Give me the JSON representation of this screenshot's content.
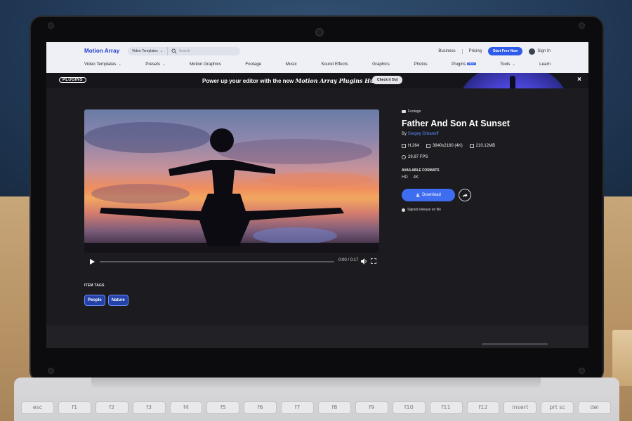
{
  "site": {
    "logo": "Motion Array",
    "search_category": "Video Templates",
    "search_placeholder": "Search",
    "top_links": [
      "Business",
      "Pricing"
    ],
    "start_button": "Start Free Now",
    "sign_in": "Sign In"
  },
  "nav": [
    {
      "label": "Video Templates",
      "chevron": true
    },
    {
      "label": "Presets",
      "chevron": true
    },
    {
      "label": "Motion Graphics"
    },
    {
      "label": "Footage"
    },
    {
      "label": "Music"
    },
    {
      "label": "Sound Effects"
    },
    {
      "label": "Graphics"
    },
    {
      "label": "Photos"
    },
    {
      "label": "Plugins",
      "badge": "NEW"
    },
    {
      "label": "Tools",
      "chevron": true
    },
    {
      "label": "Learn"
    }
  ],
  "promo": {
    "logo": "PLUGINS",
    "text_prefix": "Power up your editor with the new",
    "text_brand": "Motion Array Plugins Hub",
    "button": "Check it Out",
    "close": "×"
  },
  "video": {
    "time": "0:00 / 0:17",
    "progress": 0
  },
  "item_tags_label": "ITEM TAGS",
  "tags": [
    "People",
    "Nature"
  ],
  "item": {
    "category": "Footage",
    "title": "Father And Son At Sunset",
    "author_prefix": "By",
    "author": "Sergey Grbanoff",
    "codec": "H.264",
    "resolution": "3840x2160 (4K)",
    "size": "210.12MB",
    "fps": "29.97 FPS",
    "formats_label": "AVAILABLE FORMATS",
    "formats": [
      "HD",
      "4K"
    ],
    "download": "Download",
    "signed": "Signed release on file"
  },
  "keyboard": [
    "esc",
    "f1",
    "f2",
    "f3",
    "f4",
    "f5",
    "f6",
    "f7",
    "f8",
    "f9",
    "f10",
    "f11",
    "f12",
    "insert",
    "prt sc",
    "del"
  ],
  "colors": {
    "accent": "#2f5bea",
    "tag": "#2441a8"
  }
}
